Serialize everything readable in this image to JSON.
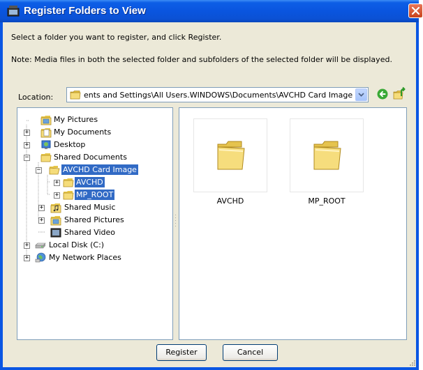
{
  "window": {
    "title": "Register Folders to View"
  },
  "instructions": {
    "line1": "Select a folder you want to register, and click Register.",
    "line2": "Note: Media files in both the selected folder and subfolders of the selected folder will be displayed."
  },
  "location": {
    "label": "Location:",
    "path": "ents and Settings\\All Users.WINDOWS\\Documents\\AVCHD Card Image"
  },
  "tree": {
    "items": [
      {
        "label": "My Pictures"
      },
      {
        "label": "My Documents"
      },
      {
        "label": "Desktop"
      },
      {
        "label": "Shared Documents"
      },
      {
        "label": "AVCHD Card Image"
      },
      {
        "label": "AVCHD"
      },
      {
        "label": "MP_ROOT"
      },
      {
        "label": "Shared Music"
      },
      {
        "label": "Shared Pictures"
      },
      {
        "label": "Shared Video"
      },
      {
        "label": "Local Disk (C:)"
      },
      {
        "label": "My Network Places"
      }
    ]
  },
  "content": {
    "items": [
      {
        "label": "AVCHD"
      },
      {
        "label": "MP_ROOT"
      }
    ]
  },
  "buttons": {
    "register": "Register",
    "cancel": "Cancel"
  },
  "colors": {
    "selection": "#316ac5",
    "titlebar": "#0a55df",
    "dialog": "#ece9d8"
  }
}
